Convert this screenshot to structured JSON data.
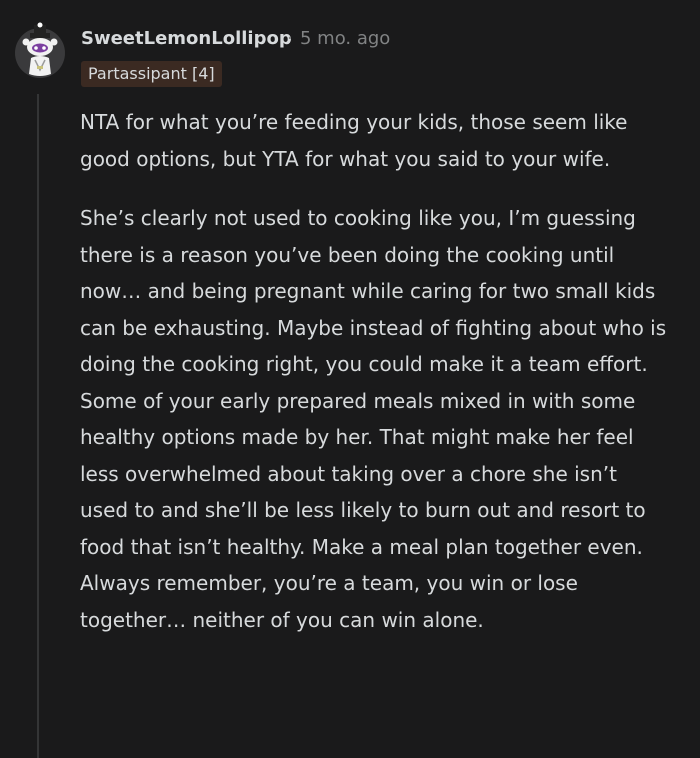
{
  "comment": {
    "username": "SweetLemonLollipop",
    "separator": "·",
    "timestamp": "5 mo. ago",
    "flair": "Partassipant [4]",
    "paragraphs": [
      "NTA for what you’re feeding your kids, those seem like good options, but YTA for what you said to your wife.",
      "She’s clearly not used to cooking like you, I’m guessing there is a reason you’ve been doing the cooking until now… and being pregnant while caring for two small kids can be exhausting. Maybe instead of fighting about who is doing the cooking right, you could make it a team effort. Some of your early prepared meals mixed in with some healthy options made by her. That might make her feel less overwhelmed about taking over a chore she isn’t used to and she’ll be less likely to burn out and resort to food that isn’t healthy. Make a meal plan together even. Always remember, you’re a team, you win or lose together… neither of you can win alone."
    ]
  },
  "avatar": {
    "icon": "snoo-avatar-icon"
  },
  "colors": {
    "background": "#1a1a1b",
    "text": "#d7dadc",
    "meta": "#818384",
    "flair_bg": "#3b2a22",
    "thread_line": "#343536"
  }
}
